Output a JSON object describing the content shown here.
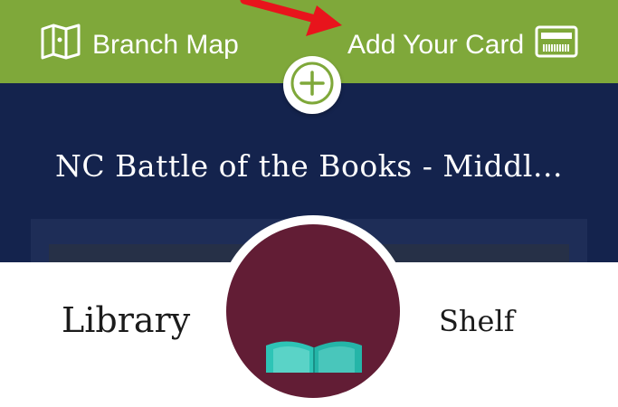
{
  "topbar": {
    "branch_map_label": "Branch Map",
    "add_card_label": "Add Your Card",
    "branch_map_icon": "map-icon",
    "add_card_icon": "card-icon",
    "plus_icon": "plus-icon"
  },
  "hero": {
    "title": "NC Battle of the Books - Middl..."
  },
  "tabs": {
    "library_label": "Library",
    "shelf_label": "Shelf",
    "center_icon": "open-book-icon"
  },
  "colors": {
    "topbar_green": "#7fa83a",
    "hero_navy": "#14234d",
    "center_maroon": "#621d35",
    "book_teal": "#2ec4b6",
    "arrow_red": "#e8141c"
  }
}
